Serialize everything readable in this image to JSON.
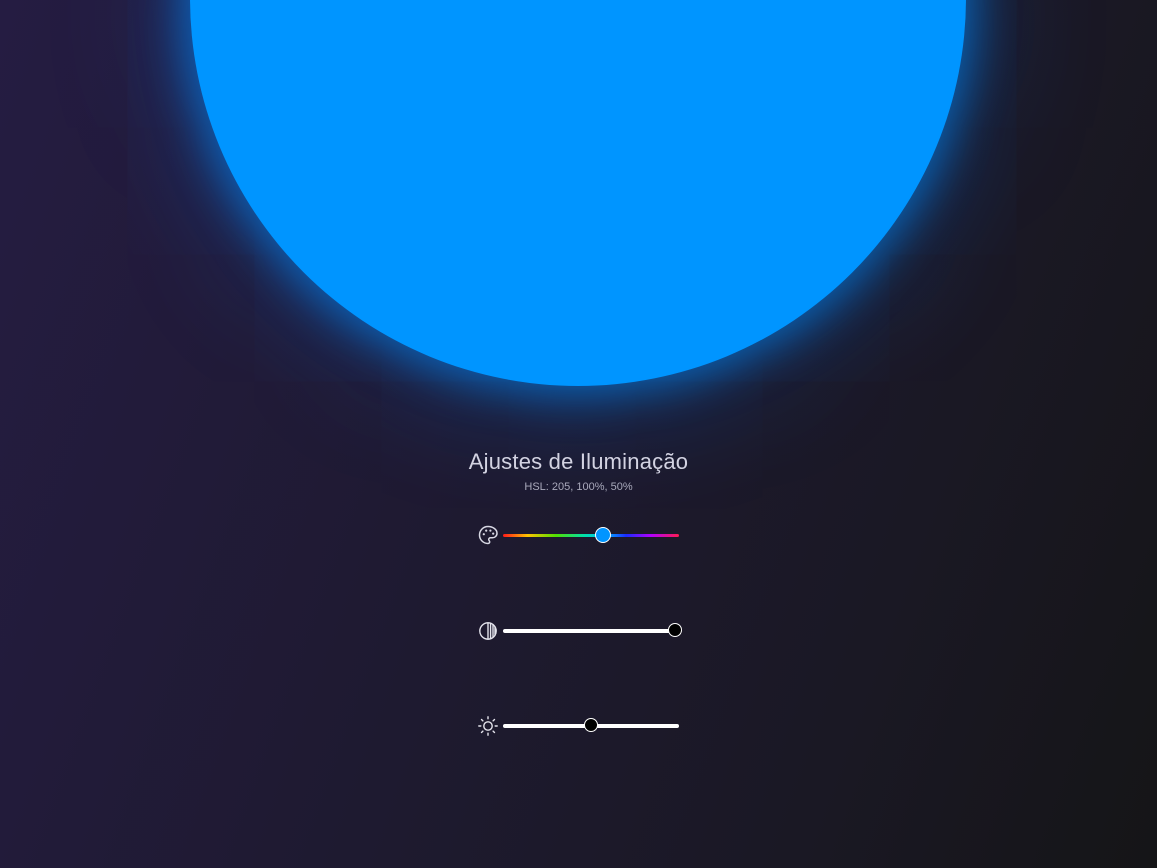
{
  "panel": {
    "title": "Ajustes de Iluminação",
    "hsl_readout": "HSL: 205, 100%, 50%"
  },
  "light": {
    "color": "#0095ff"
  },
  "controls": [
    {
      "name": "hue",
      "icon": "palette-icon",
      "min": 0,
      "max": 360,
      "value": 205,
      "thumb_color": "#0095ff"
    },
    {
      "name": "saturation",
      "icon": "contrast-icon",
      "min": 0,
      "max": 100,
      "value": 100,
      "thumb_color": "#000000"
    },
    {
      "name": "lightness",
      "icon": "sun-icon",
      "min": 0,
      "max": 100,
      "value": 50,
      "thumb_color": "#000000"
    }
  ]
}
